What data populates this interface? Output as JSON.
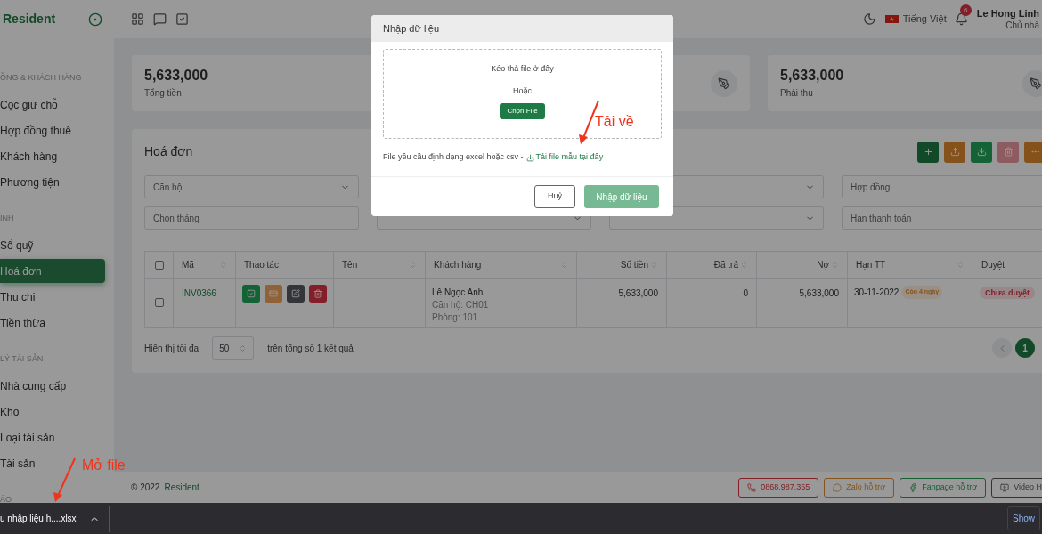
{
  "header": {
    "brand": "Resident",
    "language": "Tiếng Việt",
    "notification_count": "6",
    "user_name": "Le Hong Linh",
    "user_role": "Chủ nhà"
  },
  "sidebar": {
    "sections": [
      {
        "label": "ỒNG & KHÁCH HÀNG",
        "items": [
          {
            "label": "Cọc giữ chỗ",
            "selected": false
          },
          {
            "label": "Hợp đồng thuê",
            "selected": false
          },
          {
            "label": "Khách hàng",
            "selected": false
          },
          {
            "label": "Phương tiện",
            "selected": false
          }
        ]
      },
      {
        "label": "ÍNH",
        "items": [
          {
            "label": "Sổ quỹ",
            "selected": false
          },
          {
            "label": "Hoá đơn",
            "selected": true
          },
          {
            "label": "Thu chi",
            "selected": false
          },
          {
            "label": "Tiền thừa",
            "selected": false
          }
        ]
      },
      {
        "label": "LÝ TÀI SẢN",
        "items": [
          {
            "label": "Nhà cung cấp",
            "selected": false
          },
          {
            "label": "Kho",
            "selected": false
          },
          {
            "label": "Loại tài sản",
            "selected": false
          },
          {
            "label": "Tài sản",
            "selected": false
          }
        ]
      },
      {
        "label": "ÁO"
      }
    ]
  },
  "stat_cards": [
    {
      "kind": "text_only",
      "value": "5,633,000",
      "label": "Tổng tiền"
    },
    {
      "kind": "icon_only"
    },
    {
      "kind": "full",
      "value": "5,633,000",
      "label": "Phải thu"
    }
  ],
  "invoices": {
    "title": "Hoá đơn",
    "toolbar": [
      {
        "kind": "add",
        "disabled": false
      },
      {
        "kind": "upload",
        "disabled": false
      },
      {
        "kind": "download",
        "disabled": false
      },
      {
        "kind": "delete",
        "disabled": true
      },
      {
        "kind": "more",
        "disabled": false
      }
    ],
    "filters": [
      {
        "kind": "select",
        "placeholder": "Căn hộ"
      },
      {
        "kind": "covered"
      },
      {
        "kind": "select"
      },
      {
        "kind": "input",
        "placeholder": "Hợp đồng"
      },
      {
        "kind": "input",
        "placeholder": "Chọn tháng"
      },
      {
        "kind": "select"
      },
      {
        "kind": "select"
      },
      {
        "kind": "input",
        "placeholder": "Hạn thanh toán"
      }
    ],
    "columns": [
      {
        "kind": "checkbox",
        "checked": false
      },
      {
        "kind": "text",
        "label": "Mã",
        "sortable": true
      },
      {
        "kind": "text",
        "label": "Thao tác",
        "sortable": false
      },
      {
        "kind": "text",
        "label": "Tên",
        "sortable": true
      },
      {
        "kind": "text",
        "label": "Khách hàng",
        "sortable": true
      },
      {
        "kind": "numeric",
        "label": "Số tiền",
        "sortable": true
      },
      {
        "kind": "numeric",
        "label": "Đã trả",
        "sortable": true
      },
      {
        "kind": "numeric",
        "label": "Nợ",
        "sortable": true
      },
      {
        "kind": "text",
        "label": "Hạn TT",
        "sortable": true
      },
      {
        "kind": "text",
        "label": "Duyệt"
      }
    ],
    "rows": [
      {
        "checked": false,
        "code": "INV0366",
        "actions": [
          {
            "kind": "approve"
          },
          {
            "kind": "payment"
          },
          {
            "kind": "edit"
          },
          {
            "kind": "delete"
          }
        ],
        "customer": {
          "name": "Lê Ngọc Anh",
          "details": [
            "Căn hộ: CH01",
            "Phòng: 101"
          ]
        },
        "amount": "5,633,000",
        "paid": "0",
        "debt": "5,633,000",
        "due_date": "30-11-2022",
        "due_badge": "Còn 4 ngày",
        "status": "Chưa duyệt"
      }
    ],
    "pagination": {
      "show_label": "Hiển thị tối đa",
      "page_size": "50",
      "total_text": "trên tổng số 1 kết quả",
      "pages": [
        {
          "label": "1",
          "selected": true
        }
      ]
    }
  },
  "footer": {
    "copyright": "© 2022",
    "brand": "Resident",
    "support": [
      {
        "kind": "phone",
        "label": "0868.987.355"
      },
      {
        "kind": "zalo",
        "label": "Zalo hỗ trợ"
      },
      {
        "kind": "facebook",
        "label": "Fanpage hỗ trợ"
      },
      {
        "kind": "video",
        "label": "Video H"
      }
    ]
  },
  "modal": {
    "title": "Nhập dữ liệu",
    "drop_text": "Kéo thả file ở đây",
    "or_text": "Hoặc",
    "choose_button": "Chọn File",
    "hint": "File yêu cầu định dạng excel hoặc csv -",
    "template_link": "Tải file mẫu tại đây",
    "cancel_button": "Huỷ",
    "submit_button": {
      "label": "Nhập dữ liệu",
      "disabled": true
    }
  },
  "annotations": [
    {
      "text": "Tải về"
    },
    {
      "text": "Mở file"
    }
  ],
  "download_bar": {
    "file_name": "u nhập liệu h....xlsx",
    "show_all": "Show"
  }
}
